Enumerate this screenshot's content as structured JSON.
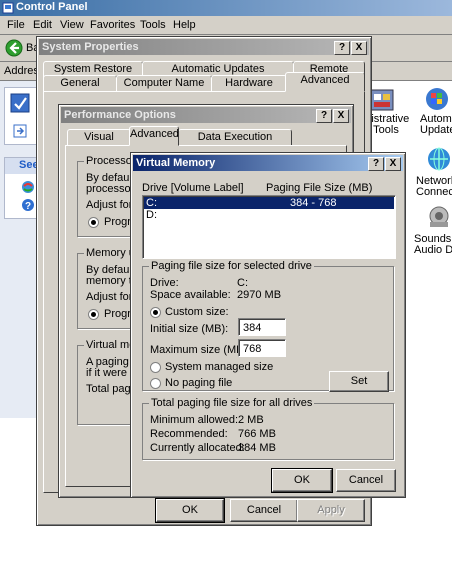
{
  "control_panel": {
    "title": "Control Panel",
    "menu": [
      "File",
      "Edit",
      "View",
      "Favorites",
      "Tools",
      "Help"
    ],
    "back_label": "Ba",
    "address_label": "Address",
    "see_label": "See",
    "right_icons": [
      {
        "label": "inistrative\nTools",
        "icon": "tools-icon"
      },
      {
        "label": "Automat\nUpdates",
        "icon": "updates-icon"
      },
      {
        "label": "Network\nConnectio",
        "icon": "network-icon"
      },
      {
        "label": "Sounds a\nAudio Dev",
        "icon": "sounds-icon"
      }
    ]
  },
  "system_properties": {
    "title": "System Properties",
    "tabs_row1": [
      "System Restore",
      "Automatic Updates",
      "Remote"
    ],
    "tabs_row2": [
      "General",
      "Computer Name",
      "Hardware",
      "Advanced"
    ],
    "selected_tab": "Advanced",
    "buttons": {
      "ok": "OK",
      "cancel": "Cancel",
      "apply": "Apply"
    }
  },
  "performance_options": {
    "title": "Performance Options",
    "tabs": [
      "Visual Effects",
      "Advanced",
      "Data Execution Prevention"
    ],
    "selected_tab": "Advanced",
    "processor": {
      "label": "Processor s",
      "text1": "By default,",
      "text2": "processor ti",
      "adjust": "Adjust for b",
      "radio": "Program"
    },
    "memory": {
      "label": "Memory usa",
      "text1": "By default,",
      "text2": "memory to r",
      "adjust": "Adjust for b",
      "radio": "Program"
    },
    "virtual": {
      "label": "Virtual mem",
      "text1": "A paging file",
      "text2": "if it were RA",
      "total": "Total paging"
    }
  },
  "virtual_memory": {
    "title": "Virtual Memory",
    "col_drive": "Drive  [Volume Label]",
    "col_size": "Paging File Size (MB)",
    "drives": [
      {
        "drive": "C:",
        "size": "384 - 768",
        "selected": true
      },
      {
        "drive": "D:",
        "size": "",
        "selected": false
      }
    ],
    "selected_group": {
      "label": "Paging file size for selected drive",
      "drive_label": "Drive:",
      "drive_value": "C:",
      "space_label": "Space available:",
      "space_value": "2970 MB",
      "custom_label": "Custom size:",
      "initial_label": "Initial size (MB):",
      "initial_value": "384",
      "maximum_label": "Maximum size (MB):",
      "maximum_value": "768",
      "system_managed_label": "System managed size",
      "no_paging_label": "No paging file",
      "set_button": "Set",
      "selected_option": "custom"
    },
    "total_group": {
      "label": "Total paging file size for all drives",
      "min_label": "Minimum allowed:",
      "min_value": "2 MB",
      "rec_label": "Recommended:",
      "rec_value": "766 MB",
      "cur_label": "Currently allocated:",
      "cur_value": "384 MB"
    },
    "buttons": {
      "ok": "OK",
      "cancel": "Cancel"
    }
  },
  "title_buttons": {
    "help": "?",
    "close": "X"
  },
  "colors": {
    "active_title": "#0a246a",
    "inactive_title": "#808080",
    "face": "#d4d0c8",
    "selection": "#0a246a"
  }
}
